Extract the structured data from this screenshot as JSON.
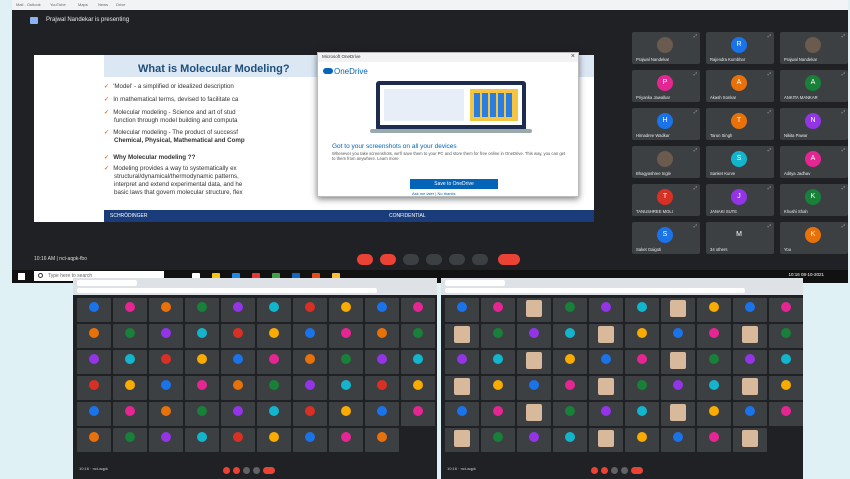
{
  "meeting": {
    "presenter_label": "Prajwal Nandekar is presenting",
    "time_code": "10:16 AM | nct-aqpk-fbo",
    "browser_tabs": [
      "Mail - Outlook",
      "YouTube",
      "Maps",
      "News",
      "Drive"
    ],
    "colors": {
      "bg": "#202124",
      "tile": "#3c4043",
      "end_call": "#ea4335",
      "accent": "#8ab4f8"
    }
  },
  "slide": {
    "title": "What is Molecular Modeling?",
    "bullets": [
      "'Model' - a simplified or idealized description",
      "In mathematical terms, devised to facilitate ca",
      "Molecular modeling - Science and art of stud",
      "function through model building and computa",
      "Molecular modeling - The product of successf",
      "Chemical, Physical, Mathematical and Comp",
      "Why Molecular modeling ??",
      "Modeling provides a way to systematically ex",
      "structural/dynamical/thermodynamic patterns,",
      "interpret and extend experimental data, and he",
      "basic laws that govern molecular structure, flex"
    ],
    "footer_brand": "SCHRÖDINGER",
    "footer_center": "CONFIDENTIAL"
  },
  "onedrive": {
    "window_title": "Microsoft OneDrive",
    "brand": "OneDrive",
    "heading": "Got to your screenshots on all your devices",
    "description": "Whenever you take screenshots, we'll save them to your PC and store them for free online in OneDrive. This way, you can get to them from anywhere. Learn more",
    "save_button": "Save to OneDrive",
    "links": "Ask me later  |  No thanks"
  },
  "participants": [
    {
      "name": "Prajwal Nandekar",
      "initial": "",
      "color": "#6b5a4e",
      "photo": true
    },
    {
      "name": "Rajendra Kumbhar",
      "initial": "R",
      "color": "#1a73e8"
    },
    {
      "name": "Prajwal Nandekar",
      "initial": "",
      "color": "#6b5a4e",
      "photo": true
    },
    {
      "name": "Priyanka Jawalkar",
      "initial": "P",
      "color": "#e52592"
    },
    {
      "name": "Akash Sonkar",
      "initial": "A",
      "color": "#e8710a"
    },
    {
      "name": "ANKITA MANKAR",
      "initial": "A",
      "color": "#188038"
    },
    {
      "name": "Himadree Wadkar",
      "initial": "H",
      "color": "#1a73e8"
    },
    {
      "name": "Tarun Singh",
      "initial": "T",
      "color": "#e8710a"
    },
    {
      "name": "Nikita Pawar",
      "initial": "N",
      "color": "#9334e6"
    },
    {
      "name": "Bhagyashree Ingle",
      "initial": "",
      "color": "#6b5a4e",
      "photo": true
    },
    {
      "name": "Sanket Kurve",
      "initial": "S",
      "color": "#12b5cb"
    },
    {
      "name": "Aditya Jadhav",
      "initial": "A",
      "color": "#e52592"
    },
    {
      "name": "TANUSHREE MOLI",
      "initial": "T",
      "color": "#d93025"
    },
    {
      "name": "JANAKI SUTE",
      "initial": "J",
      "color": "#9334e6"
    },
    {
      "name": "Khushi Shah",
      "initial": "K",
      "color": "#188038"
    },
    {
      "name": "Saket Gaigoti",
      "initial": "S",
      "color": "#1a73e8"
    },
    {
      "name": "34 others",
      "initial": "M",
      "color": "#3c4043"
    },
    {
      "name": "You",
      "initial": "K",
      "color": "#e8710a"
    }
  ],
  "taskbar": {
    "search_placeholder": "Type here to search",
    "clock": "10:16",
    "date": "08-10-2021"
  },
  "bottom_left": {
    "time_code": "10:16 · nct-aqpk"
  },
  "bottom_right": {
    "time_code": "10:16 · nct-aqpk"
  }
}
